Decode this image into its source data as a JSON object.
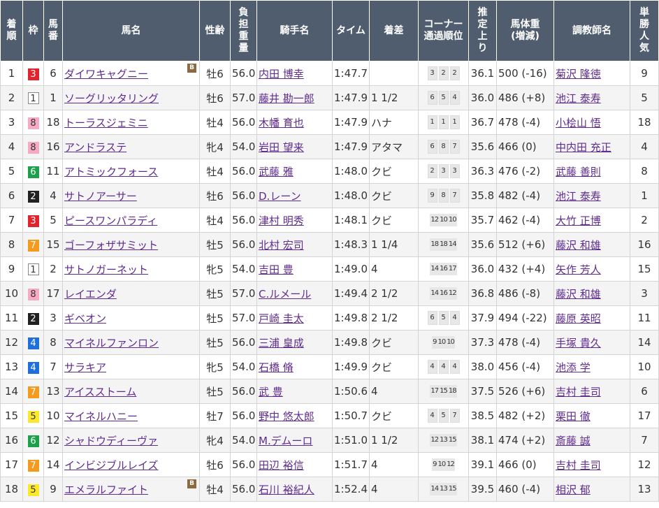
{
  "headers": {
    "rank": "着順",
    "waku": "枠",
    "umaban": "馬番",
    "horse": "馬名",
    "sexage": "性齢",
    "weight": "負担重量",
    "jockey": "騎手名",
    "time": "タイム",
    "margin": "着差",
    "corner": "コーナー通過順位",
    "last3f": "推定上り",
    "bodyweight": "馬体重(増減)",
    "trainer": "調教師名",
    "pop": "単勝人気"
  },
  "blinker_label": "B",
  "waku_colors": {
    "1": "#ffffff",
    "2": "#222222",
    "3": "#e0232c",
    "4": "#1e6fd9",
    "5": "#fce82b",
    "6": "#1ca14a",
    "7": "#f39a1f",
    "8": "#f7aac6"
  },
  "header_bg": "#4f5d6e",
  "link_color": "#5f2c8f",
  "rows": [
    {
      "rank": "1",
      "waku": "3",
      "umaban": "6",
      "horse": "ダイワキャグニー",
      "blinker": true,
      "sexage": "牡6",
      "weight": "56.0",
      "jockey": "内田 博幸",
      "time": "1:47.7",
      "margin": "",
      "corner": [
        "3",
        "2",
        "2"
      ],
      "last3f": "36.1",
      "bodyweight": "500 (-16)",
      "trainer": "菊沢 隆徳",
      "pop": "9"
    },
    {
      "rank": "2",
      "waku": "1",
      "umaban": "1",
      "horse": "ソーグリッタリング",
      "blinker": false,
      "sexage": "牡6",
      "weight": "57.0",
      "jockey": "藤井 勘一郎",
      "time": "1:47.9",
      "margin": "1 1/2",
      "corner": [
        "6",
        "5",
        "4"
      ],
      "last3f": "36.0",
      "bodyweight": "486 (+8)",
      "trainer": "池江 泰寿",
      "pop": "5"
    },
    {
      "rank": "3",
      "waku": "8",
      "umaban": "18",
      "horse": "トーラスジェミニ",
      "blinker": false,
      "sexage": "牡4",
      "weight": "56.0",
      "jockey": "木幡 育也",
      "time": "1:47.9",
      "margin": "ハナ",
      "corner": [
        "1",
        "1",
        "1"
      ],
      "last3f": "36.7",
      "bodyweight": "478 (-4)",
      "trainer": "小桧山 悟",
      "pop": "18"
    },
    {
      "rank": "4",
      "waku": "8",
      "umaban": "16",
      "horse": "アンドラステ",
      "blinker": false,
      "sexage": "牝4",
      "weight": "54.0",
      "jockey": "岩田 望来",
      "time": "1:47.9",
      "margin": "アタマ",
      "corner": [
        "6",
        "8",
        "7"
      ],
      "last3f": "35.6",
      "bodyweight": "466 (0)",
      "trainer": "中内田 充正",
      "pop": "4"
    },
    {
      "rank": "5",
      "waku": "6",
      "umaban": "11",
      "horse": "アトミックフォース",
      "blinker": false,
      "sexage": "牡4",
      "weight": "56.0",
      "jockey": "武藤 雅",
      "time": "1:48.0",
      "margin": "クビ",
      "corner": [
        "2",
        "3",
        "3"
      ],
      "last3f": "36.3",
      "bodyweight": "476 (-2)",
      "trainer": "武藤 善則",
      "pop": "8"
    },
    {
      "rank": "6",
      "waku": "2",
      "umaban": "4",
      "horse": "サトノアーサー",
      "blinker": false,
      "sexage": "牡6",
      "weight": "56.0",
      "jockey": "D.レーン",
      "time": "1:48.0",
      "margin": "クビ",
      "corner": [
        "9",
        "8",
        "7"
      ],
      "last3f": "35.8",
      "bodyweight": "482 (-4)",
      "trainer": "池江 泰寿",
      "pop": "1"
    },
    {
      "rank": "7",
      "waku": "3",
      "umaban": "5",
      "horse": "ピースワンパラディ",
      "blinker": false,
      "sexage": "牡4",
      "weight": "56.0",
      "jockey": "津村 明秀",
      "time": "1:48.1",
      "margin": "クビ",
      "corner": [
        "12",
        "10",
        "10"
      ],
      "last3f": "35.7",
      "bodyweight": "462 (-4)",
      "trainer": "大竹 正博",
      "pop": "2"
    },
    {
      "rank": "8",
      "waku": "7",
      "umaban": "15",
      "horse": "ゴーフォザサミット",
      "blinker": false,
      "sexage": "牡5",
      "weight": "56.0",
      "jockey": "北村 宏司",
      "time": "1:48.3",
      "margin": "1 1/4",
      "corner": [
        "18",
        "18",
        "14"
      ],
      "last3f": "35.6",
      "bodyweight": "512 (+6)",
      "trainer": "藤沢 和雄",
      "pop": "16"
    },
    {
      "rank": "9",
      "waku": "1",
      "umaban": "2",
      "horse": "サトノガーネット",
      "blinker": false,
      "sexage": "牝5",
      "weight": "54.0",
      "jockey": "吉田 豊",
      "time": "1:49.0",
      "margin": "4",
      "corner": [
        "14",
        "16",
        "17"
      ],
      "last3f": "36.0",
      "bodyweight": "432 (+4)",
      "trainer": "矢作 芳人",
      "pop": "15"
    },
    {
      "rank": "10",
      "waku": "8",
      "umaban": "17",
      "horse": "レイエンダ",
      "blinker": false,
      "sexage": "牡5",
      "weight": "57.0",
      "jockey": "C.ルメール",
      "time": "1:49.4",
      "margin": "2 1/2",
      "corner": [
        "14",
        "16",
        "12"
      ],
      "last3f": "36.8",
      "bodyweight": "486 (-8)",
      "trainer": "藤沢 和雄",
      "pop": "3"
    },
    {
      "rank": "11",
      "waku": "2",
      "umaban": "3",
      "horse": "ギベオン",
      "blinker": false,
      "sexage": "牡5",
      "weight": "57.0",
      "jockey": "戸崎 圭太",
      "time": "1:49.8",
      "margin": "2 1/2",
      "corner": [
        "6",
        "5",
        "4"
      ],
      "last3f": "37.9",
      "bodyweight": "494 (-22)",
      "trainer": "藤原 英昭",
      "pop": "11"
    },
    {
      "rank": "12",
      "waku": "4",
      "umaban": "8",
      "horse": "マイネルファンロン",
      "blinker": false,
      "sexage": "牡5",
      "weight": "56.0",
      "jockey": "三浦 皇成",
      "time": "1:49.8",
      "margin": "クビ",
      "corner": [
        "9",
        "10",
        "10"
      ],
      "last3f": "37.3",
      "bodyweight": "478 (-4)",
      "trainer": "手塚 貴久",
      "pop": "14"
    },
    {
      "rank": "13",
      "waku": "4",
      "umaban": "7",
      "horse": "サラキア",
      "blinker": false,
      "sexage": "牝5",
      "weight": "54.0",
      "jockey": "石橋 脩",
      "time": "1:49.9",
      "margin": "クビ",
      "corner": [
        "4",
        "4",
        "4"
      ],
      "last3f": "38.0",
      "bodyweight": "456 (-4)",
      "trainer": "池添 学",
      "pop": "10"
    },
    {
      "rank": "14",
      "waku": "7",
      "umaban": "13",
      "horse": "アイスストーム",
      "blinker": false,
      "sexage": "牡5",
      "weight": "56.0",
      "jockey": "武 豊",
      "time": "1:50.6",
      "margin": "4",
      "corner": [
        "17",
        "15",
        "18"
      ],
      "last3f": "37.5",
      "bodyweight": "526 (+6)",
      "trainer": "吉村 圭司",
      "pop": "6"
    },
    {
      "rank": "15",
      "waku": "5",
      "umaban": "10",
      "horse": "マイネルハニー",
      "blinker": false,
      "sexage": "牡7",
      "weight": "56.0",
      "jockey": "野中 悠太郎",
      "time": "1:50.7",
      "margin": "クビ",
      "corner": [
        "4",
        "5",
        "7"
      ],
      "last3f": "38.5",
      "bodyweight": "482 (+2)",
      "trainer": "栗田 徹",
      "pop": "17"
    },
    {
      "rank": "16",
      "waku": "6",
      "umaban": "12",
      "horse": "シャドウディーヴァ",
      "blinker": false,
      "sexage": "牝4",
      "weight": "54.0",
      "jockey": "M.デムーロ",
      "time": "1:51.0",
      "margin": "1 1/2",
      "corner": [
        "12",
        "13",
        "15"
      ],
      "last3f": "38.1",
      "bodyweight": "474 (+2)",
      "trainer": "斎藤 誠",
      "pop": "7"
    },
    {
      "rank": "17",
      "waku": "7",
      "umaban": "14",
      "horse": "インビジブルレイズ",
      "blinker": false,
      "sexage": "牡6",
      "weight": "56.0",
      "jockey": "田辺 裕信",
      "time": "1:51.7",
      "margin": "4",
      "corner": [
        "9",
        "10",
        "12"
      ],
      "last3f": "39.1",
      "bodyweight": "466 (0)",
      "trainer": "吉村 圭司",
      "pop": "12"
    },
    {
      "rank": "18",
      "waku": "5",
      "umaban": "9",
      "horse": "エメラルファイト",
      "blinker": true,
      "sexage": "牡4",
      "weight": "56.0",
      "jockey": "石川 裕紀人",
      "time": "1:52.4",
      "margin": "4",
      "corner": [
        "14",
        "13",
        "15"
      ],
      "last3f": "39.5",
      "bodyweight": "460 (-4)",
      "trainer": "相沢 郁",
      "pop": "13"
    }
  ]
}
